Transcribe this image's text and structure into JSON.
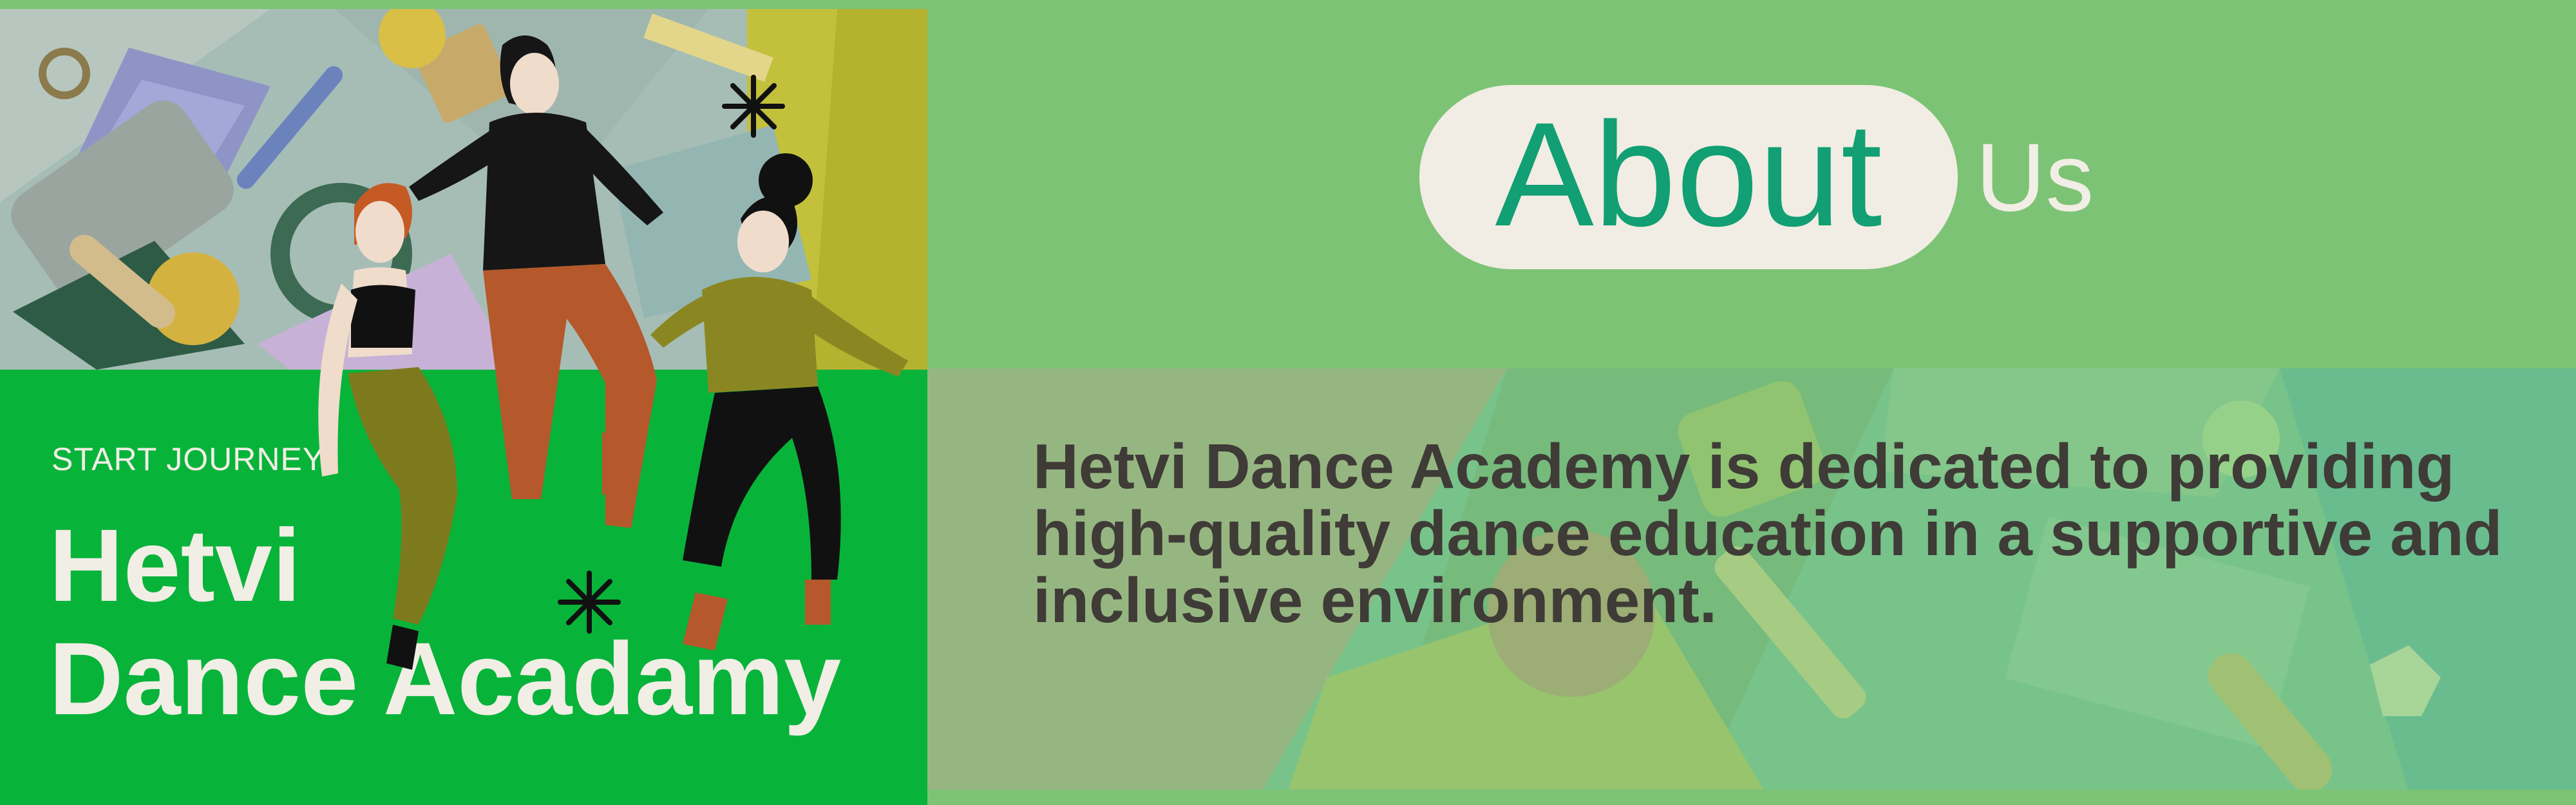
{
  "banner": {
    "kicker": "START JOURNEY",
    "title_line1": "Hetvi",
    "title_line2": "Dance Acadamy",
    "about_pill_text": "About",
    "about_suffix": "Us",
    "description": "Hetvi Dance Academy is dedicated to providing high-quality dance education in a supportive and inclusive environment."
  },
  "colors": {
    "background_green": "#7dc375",
    "panel_green": "#08b33a",
    "pill_bg": "#f1ede4",
    "pill_text": "#119f73",
    "light_text": "#f1eee5",
    "description_text": "#3f3b37"
  },
  "icons": [
    "disco-ball-icon",
    "sparkle-star-icon"
  ]
}
